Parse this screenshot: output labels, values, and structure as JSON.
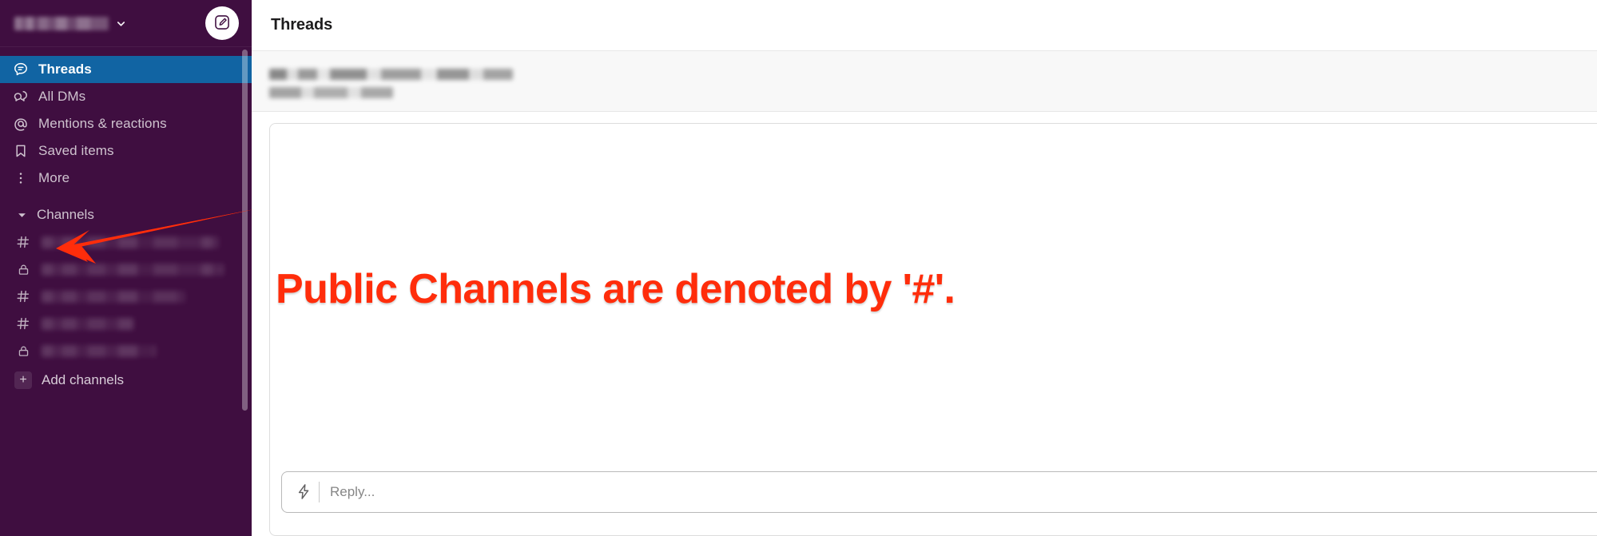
{
  "app": {
    "name": "slack-workspace",
    "theme_colors": {
      "sidebar_bg": "#3F0E40",
      "sidebar_active": "#1164A3",
      "sidebar_text": "#CFC3CF",
      "annotation_red": "#FF2D0B",
      "banner_bg": "#F8F8F8",
      "main_bg": "#FFFFFF"
    }
  },
  "sidebar": {
    "workspace": {
      "name": "",
      "name_redacted": true,
      "chevron": "⌄"
    },
    "compose_button_label": "",
    "nav_items": [
      {
        "label": "Threads",
        "icon": "threads-icon",
        "active": true
      },
      {
        "label": "All DMs",
        "icon": "dm-icon",
        "active": false
      },
      {
        "label": "Mentions & reactions",
        "icon": "at-icon",
        "active": false
      },
      {
        "label": "Saved items",
        "icon": "bookmark-icon",
        "active": false
      },
      {
        "label": "More",
        "icon": "more-vertical-icon",
        "active": false
      }
    ],
    "channels_section": {
      "label": "Channels",
      "expanded": true,
      "caret": "▼",
      "items": [
        {
          "symbol": "#",
          "type": "public",
          "name": "",
          "name_redacted": true,
          "width_class": "w1"
        },
        {
          "symbol": "🔒",
          "type": "private",
          "name": "",
          "name_redacted": true,
          "width_class": "w2"
        },
        {
          "symbol": "#",
          "type": "public",
          "name": "",
          "name_redacted": true,
          "width_class": "w3"
        },
        {
          "symbol": "#",
          "type": "public",
          "name": "",
          "name_redacted": true,
          "width_class": "w4"
        },
        {
          "symbol": "🔒",
          "type": "private",
          "name": "",
          "name_redacted": true,
          "width_class": "w5"
        }
      ],
      "add_channels_label": "Add channels",
      "add_channels_symbol": "+"
    }
  },
  "main": {
    "header_title": "Threads",
    "thread_banner": {
      "line1_redacted": true,
      "line2_redacted": true
    },
    "composer": {
      "placeholder": "Reply...",
      "shortcuts_icon": "lightning-bolt-icon"
    }
  },
  "annotation": {
    "text": "Public Channels are denoted by '#'.",
    "color": "#FF2D0B",
    "outline_color": "#FFFFFF",
    "arrow": {
      "points_to": "first-public-channel-hash",
      "direction": "left"
    }
  }
}
